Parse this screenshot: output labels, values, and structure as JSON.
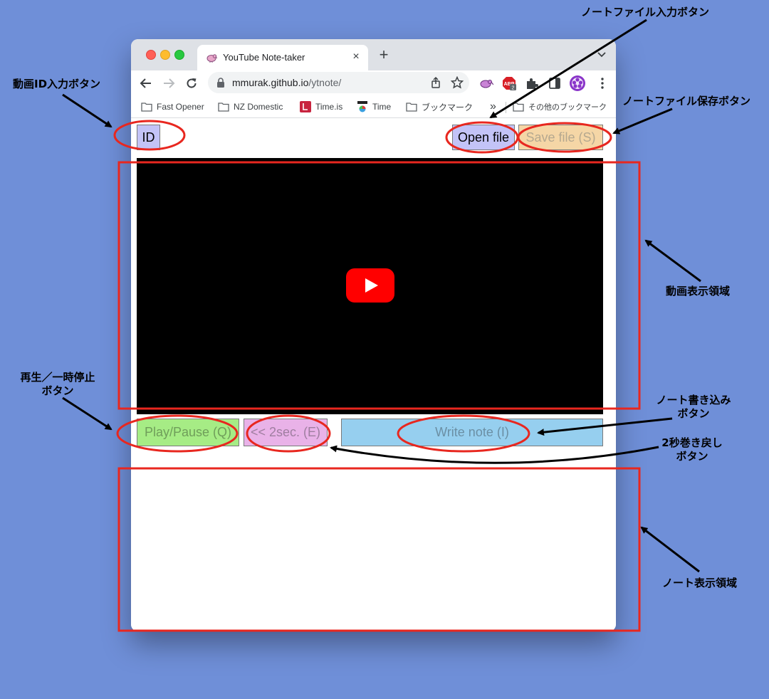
{
  "colors": {
    "desktop": "#6f8fd8",
    "annotation_red": "#e8271f",
    "youtube_red": "#ff0000",
    "button_id": "#c3c3f7",
    "button_open": "#c3c3f7",
    "button_save": "#f5d6a6",
    "button_play": "#a6ec85",
    "button_rewind": "#e9b2e8",
    "button_write": "#96cfef"
  },
  "browser": {
    "tab": {
      "title": "YouTube Note-taker",
      "favicon": "kiwi-bird-icon"
    },
    "url": {
      "host": "mmurak.github.io",
      "path": "/ytnote/"
    },
    "extension_badge": "2",
    "bookmarks": [
      {
        "label": "Fast Opener",
        "icon": "folder-icon"
      },
      {
        "label": "NZ Domestic",
        "icon": "folder-icon"
      },
      {
        "label": "Time.is",
        "icon": "time-is-icon"
      },
      {
        "label": "Time",
        "icon": "time-icon"
      },
      {
        "label": "ブックマーク",
        "icon": "folder-icon"
      }
    ],
    "bookmarks_overflow": "»",
    "other_bookmarks": "その他のブックマーク"
  },
  "app": {
    "id_button": "ID",
    "open_button": "Open file",
    "save_button": "Save file (S)",
    "play_button": "Play/Pause (Q)",
    "rewind_button": "<< 2sec. (E)",
    "write_button": "Write note (I)",
    "notes_text": ""
  },
  "annotations": {
    "id_input": "動画ID入力ボタン",
    "note_file_input": "ノートファイル入力ボタン",
    "note_file_save": "ノートファイル保存ボタン",
    "video_area": "動画表示領域",
    "play_pause_line1": "再生／一時停止",
    "play_pause_line2": "ボタン",
    "write_note_line1": "ノート書き込み",
    "write_note_line2": "ボタン",
    "rewind_line1": "2秒巻き戻し",
    "rewind_line2": "ボタン",
    "note_area": "ノート表示領域"
  }
}
